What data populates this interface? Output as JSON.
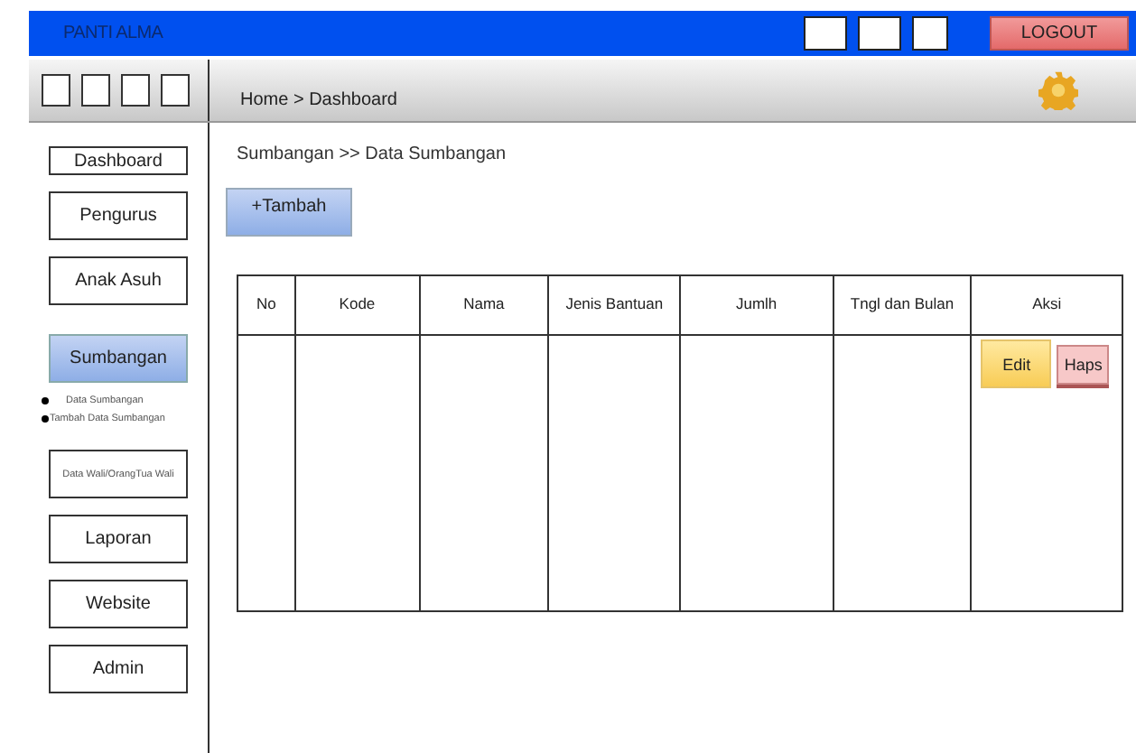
{
  "header": {
    "title": "PANTI ALMA",
    "logout": "LOGOUT"
  },
  "toolbar": {
    "breadcrumb": "Home > Dashboard"
  },
  "sidebar": {
    "items": [
      {
        "label": "Dashboard",
        "selected": false,
        "kind": "nav"
      },
      {
        "label": "Pengurus",
        "selected": false,
        "kind": "nav"
      },
      {
        "label": "Anak Asuh",
        "selected": false,
        "kind": "nav"
      },
      {
        "label": "Sumbangan",
        "selected": true,
        "kind": "nav",
        "children": [
          {
            "label": "Data Sumbangan"
          },
          {
            "label": "Tambah Data Sumbangan"
          }
        ]
      },
      {
        "label": "Data Wali/OrangTua Wali",
        "selected": false,
        "kind": "small"
      },
      {
        "label": "Laporan",
        "selected": false,
        "kind": "nav"
      },
      {
        "label": "Website",
        "selected": false,
        "kind": "nav"
      },
      {
        "label": "Admin",
        "selected": false,
        "kind": "nav"
      }
    ]
  },
  "content": {
    "path": "Sumbangan >> Data Sumbangan",
    "add_button": "+Tambah",
    "table": {
      "columns": [
        "No",
        "Kode",
        "Nama",
        "Jenis Bantuan",
        "Jumlh",
        "Tngl dan Bulan",
        "Aksi"
      ],
      "actions": [
        {
          "label": "Edit",
          "kind": "edit"
        },
        {
          "label": "Haps",
          "kind": "delete"
        }
      ]
    }
  }
}
